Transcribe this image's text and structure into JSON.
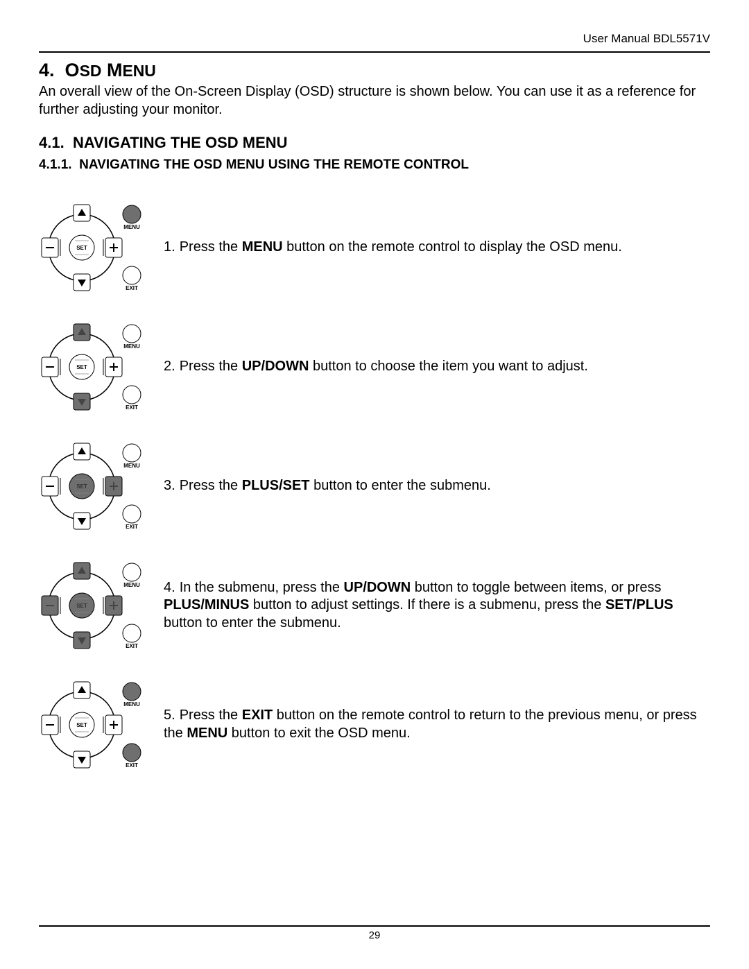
{
  "header": {
    "right": "User Manual BDL5571V"
  },
  "section": {
    "number": "4.",
    "title": "OSD MENU",
    "intro": "An overall view of the On-Screen Display (OSD) structure is shown below. You can use it as a reference for further adjusting your monitor."
  },
  "sub1": {
    "number": "4.1.",
    "title": "NAVIGATING THE OSD MENU"
  },
  "sub2": {
    "number": "4.1.1.",
    "title": "NAVIGATING THE OSD MENU USING THE REMOTE CONTROL"
  },
  "steps": [
    {
      "n": "1.",
      "pre": "Press the ",
      "b1": "MENU",
      "post1": " button on the remote control to display the OSD menu."
    },
    {
      "n": "2.",
      "pre": "Press the ",
      "b1": "UP/DOWN",
      "post1": " button to choose the item you want to adjust."
    },
    {
      "n": "3.",
      "pre": "Press the ",
      "b1": "PLUS/SET",
      "post1": " button to enter the submenu."
    },
    {
      "n": "4.",
      "pre": "In the submenu, press the ",
      "b1": "UP/DOWN",
      "post1": " button to toggle between items, or press ",
      "b2": "PLUS/MINUS",
      "post2": " button to adjust settings. If there is a submenu, press the ",
      "b3": "SET/PLUS",
      "post3": " button to enter the submenu."
    },
    {
      "n": "5.",
      "pre": "Press the ",
      "b1": "EXIT",
      "post1": " button on the remote control to return to the previous menu, or press the ",
      "b2": "MENU",
      "post2": " button to exit the OSD menu."
    }
  ],
  "remote_labels": {
    "menu": "MENU",
    "exit": "EXIT",
    "set": "SET"
  },
  "remote_icons": {
    "1": {
      "up": "w",
      "down": "w",
      "left": "w",
      "right": "w",
      "set": "w",
      "menu": "d",
      "exit": "w"
    },
    "2": {
      "up": "d",
      "down": "d",
      "left": "w",
      "right": "w",
      "set": "w",
      "menu": "w",
      "exit": "w"
    },
    "3": {
      "up": "w",
      "down": "w",
      "left": "w",
      "right": "d",
      "set": "d",
      "menu": "w",
      "exit": "w"
    },
    "4": {
      "up": "d",
      "down": "d",
      "left": "d",
      "right": "d",
      "set": "d",
      "menu": "w",
      "exit": "w"
    },
    "5": {
      "up": "w",
      "down": "w",
      "left": "w",
      "right": "w",
      "set": "w",
      "menu": "d",
      "exit": "d"
    }
  },
  "footer": {
    "page": "29"
  }
}
